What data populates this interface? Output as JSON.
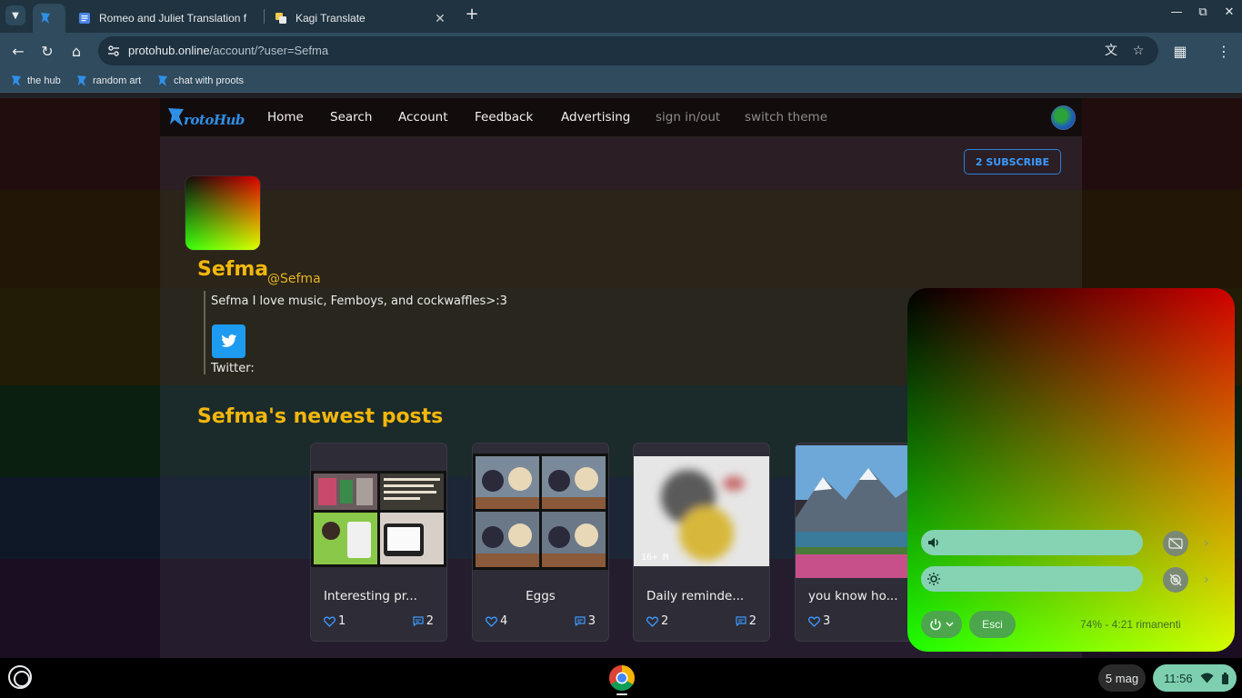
{
  "browser": {
    "tabs": [
      {
        "title": "Romeo and Juliet Translation f"
      },
      {
        "title": "Kagi Translate"
      }
    ],
    "url_host": "protohub.online",
    "url_path": "/account/?user=Sefma",
    "bookmarks": [
      {
        "label": "the hub"
      },
      {
        "label": "random art"
      },
      {
        "label": "chat with proots"
      }
    ]
  },
  "site": {
    "logo_text": "rotoHub",
    "nav": [
      {
        "label": "Home"
      },
      {
        "label": "Search"
      },
      {
        "label": "Account"
      },
      {
        "label": "Feedback"
      },
      {
        "label": "Advertising"
      },
      {
        "label": "sign in/out"
      },
      {
        "label": "switch theme"
      }
    ],
    "subscribe_label": "2 SUBSCRIBE"
  },
  "profile": {
    "display_name": "Sefma",
    "handle": "@Sefma",
    "bio": "Sefma I love music, Femboys, and cockwaffles>:3",
    "twitter_label": "Twitter:"
  },
  "posts": {
    "heading": "Sefma's newest posts",
    "items": [
      {
        "title": "Interesting pr...",
        "likes": "1",
        "comments": "2"
      },
      {
        "title": "Eggs",
        "likes": "4",
        "comments": "3"
      },
      {
        "title": "Daily reminde...",
        "likes": "2",
        "comments": "2",
        "badge": "16+ M"
      },
      {
        "title": "you know ho...",
        "likes": "3",
        "comments": ""
      }
    ]
  },
  "quick_settings": {
    "signout_label": "Esci",
    "battery_text": "74% - 4:21 rimanenti"
  },
  "shelf": {
    "date": "5 mag",
    "time": "11:56"
  },
  "colors": {
    "accent_yellow": "#f2b70e",
    "link_blue": "#3b9aff",
    "twitter_blue": "#1d9bf0"
  }
}
